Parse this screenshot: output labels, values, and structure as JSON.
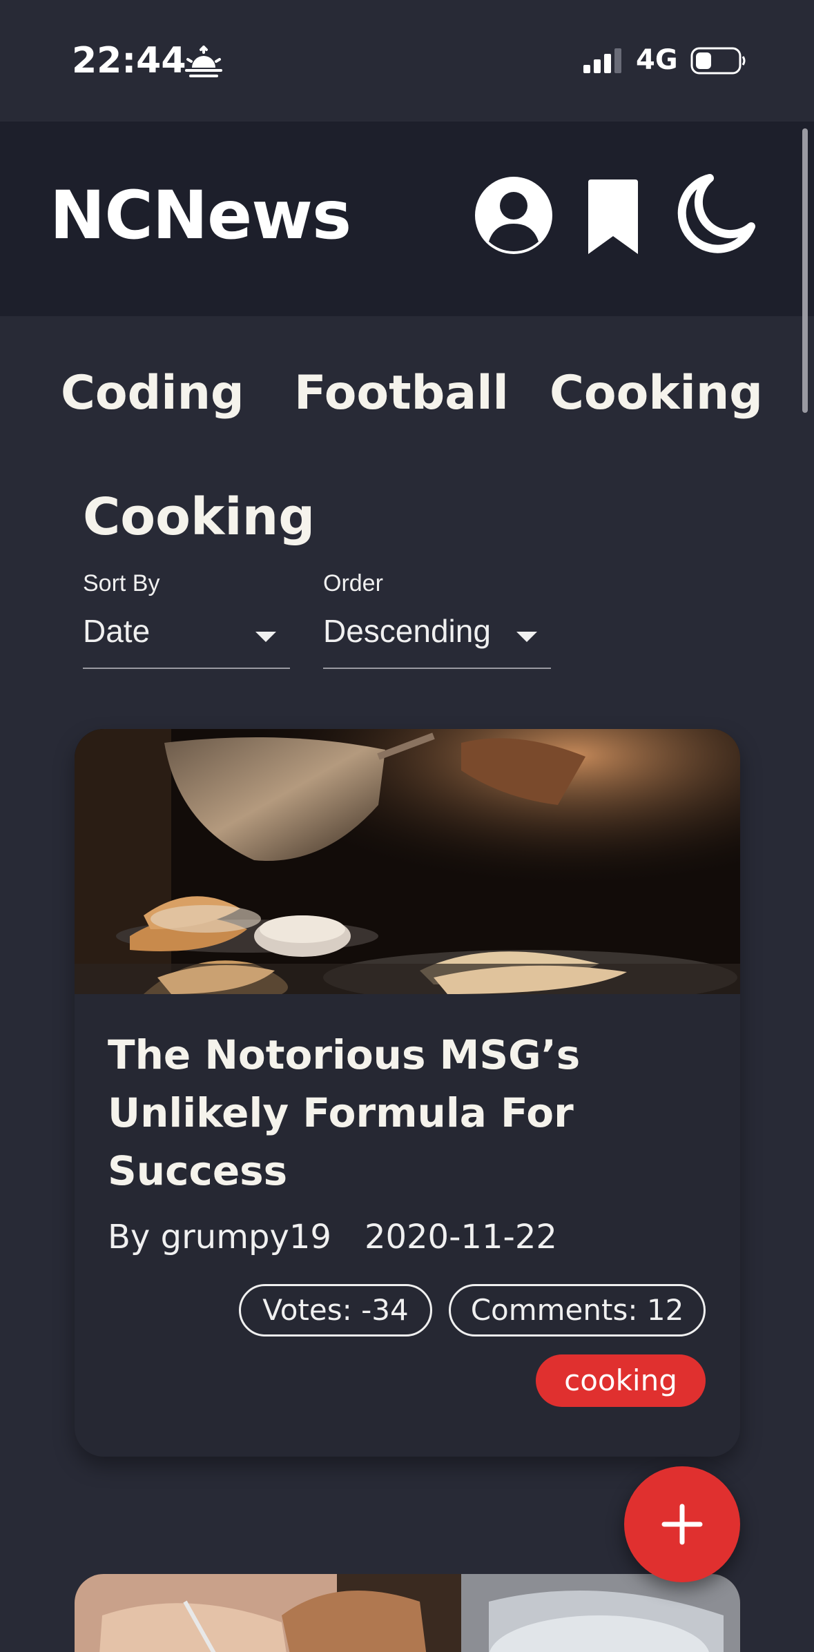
{
  "status_bar": {
    "time": "22:44",
    "network": "4G",
    "icons": [
      "sunrise-icon",
      "signal-icon",
      "battery-icon"
    ]
  },
  "header": {
    "brand": "NCNews",
    "icons": [
      "user-icon",
      "bookmark-icon",
      "moon-icon"
    ]
  },
  "topics": [
    {
      "label": "Coding"
    },
    {
      "label": "Football"
    },
    {
      "label": "Cooking"
    }
  ],
  "section": {
    "title": "Cooking"
  },
  "controls": {
    "sort_label": "Sort By",
    "sort_value": "Date",
    "order_label": "Order",
    "order_value": "Descending"
  },
  "articles": [
    {
      "title": "The Notorious MSG’s Unlikely Formula For Success",
      "author_line": "By grumpy19",
      "date": "2020-11-22",
      "votes": "Votes: -34",
      "comments": "Comments: 12",
      "topic_tag": "cooking"
    }
  ],
  "fab": {
    "icon": "plus-icon"
  },
  "colors": {
    "background": "#282a36",
    "header": "#1d1f2b",
    "card": "#262833",
    "accent": "#e0302f",
    "text": "#f5f3ec"
  }
}
